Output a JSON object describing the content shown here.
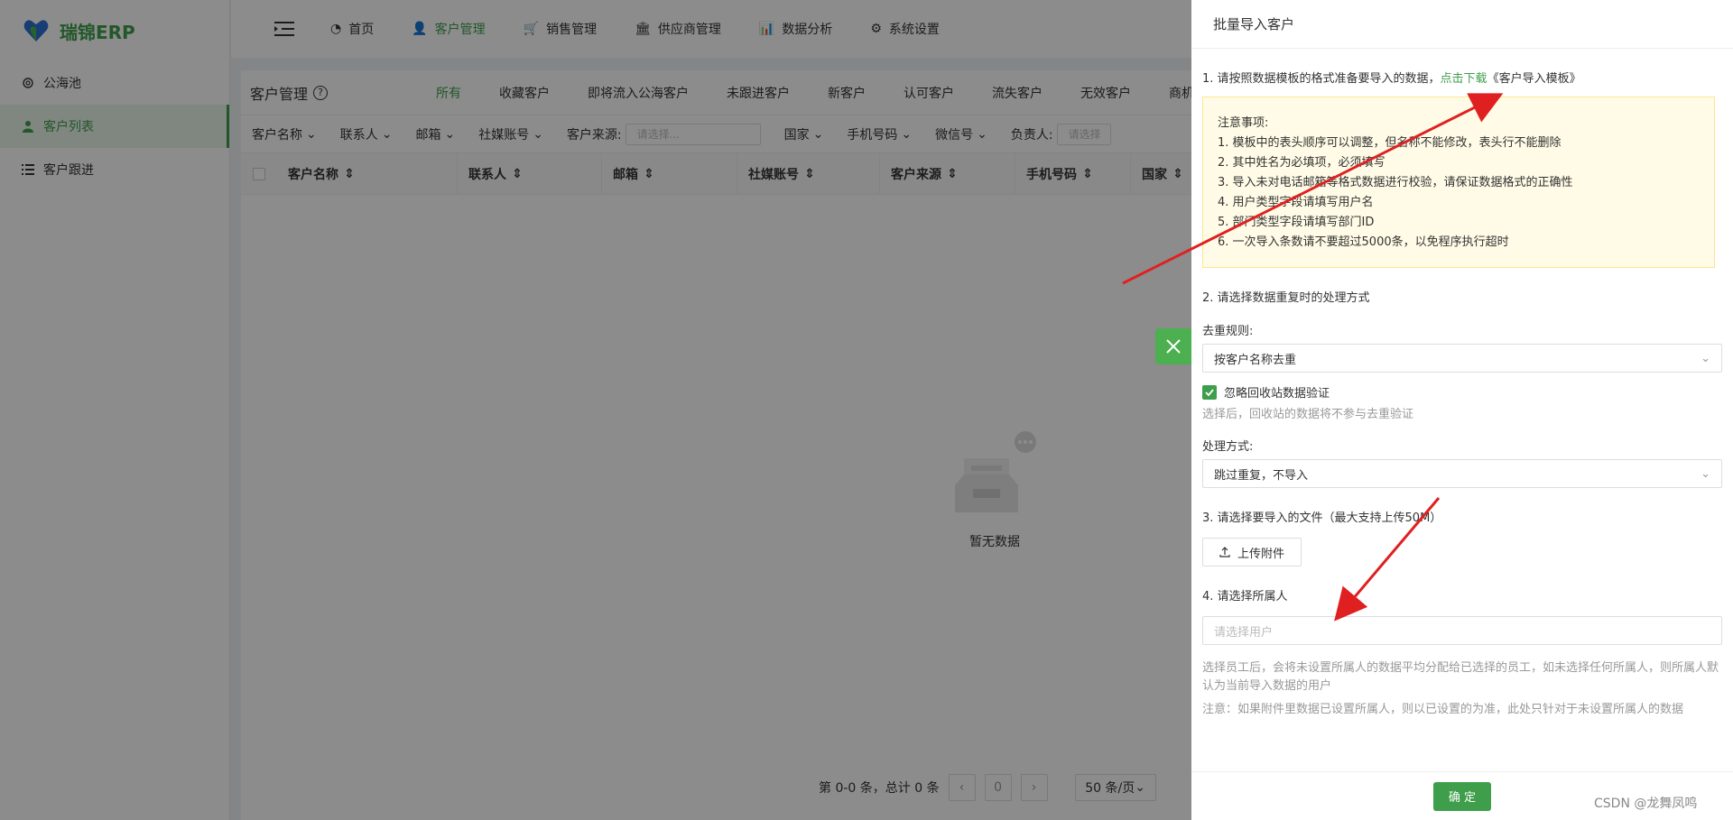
{
  "sidebar": {
    "logo_text": "瑞锦ERP",
    "items": [
      {
        "label": "公海池",
        "icon": "gear-icon"
      },
      {
        "label": "客户列表",
        "icon": "user-icon"
      },
      {
        "label": "客户跟进",
        "icon": "list-icon"
      }
    ]
  },
  "header": {
    "nav": [
      {
        "label": "首页"
      },
      {
        "label": "客户管理"
      },
      {
        "label": "销售管理"
      },
      {
        "label": "供应商管理"
      },
      {
        "label": "数据分析"
      },
      {
        "label": "系统设置"
      }
    ]
  },
  "panel": {
    "title": "客户管理",
    "tabs": [
      "所有",
      "收藏客户",
      "即将流入公海客户",
      "未跟进客户",
      "新客户",
      "认可客户",
      "流失客户",
      "无效客户",
      "商机"
    ],
    "filters": {
      "customer_name": "客户名称",
      "contact": "联系人",
      "email": "邮箱",
      "social": "社媒账号",
      "source_label": "客户来源:",
      "source_placeholder": "请选择...",
      "country": "国家",
      "phone": "手机号码",
      "wechat": "微信号",
      "owner_label": "负责人:",
      "owner_placeholder": "请选择"
    },
    "columns": [
      "客户名称",
      "联系人",
      "邮箱",
      "社媒账号",
      "客户来源",
      "手机号码",
      "国家"
    ],
    "empty_text": "暂无数据",
    "pager": {
      "summary": "第 0-0 条，总计 0 条",
      "page": "0",
      "page_size": "50 条/页"
    }
  },
  "drawer": {
    "title": "批量导入客户",
    "step1_text": "1. 请按照数据模板的格式准备要导入的数据，",
    "step1_link": "点击下载",
    "step1_template": "《客户导入模板》",
    "notice_title": "注意事项:",
    "notice_items": [
      "1. 模板中的表头顺序可以调整，但名称不能修改，表头行不能删除",
      "2. 其中姓名为必填项，必须填写",
      "3. 导入未对电话邮箱等格式数据进行校验，请保证数据格式的正确性",
      "4. 用户类型字段请填写用户名",
      "5. 部门类型字段请填写部门ID",
      "6. 一次导入条数请不要超过5000条，以免程序执行超时"
    ],
    "step2_text": "2. 请选择数据重复时的处理方式",
    "dedupe_label": "去重规则:",
    "dedupe_value": "按客户名称去重",
    "ignore_recycle_label": "忽略回收站数据验证",
    "ignore_recycle_hint": "选择后，回收站的数据将不参与去重验证",
    "process_label": "处理方式:",
    "process_value": "跳过重复，不导入",
    "step3_text": "3. 请选择要导入的文件（最大支持上传50M）",
    "upload_label": "上传附件",
    "step4_text": "4. 请选择所属人",
    "user_placeholder": "请选择用户",
    "owner_hint": "选择员工后，会将未设置所属人的数据平均分配给已选择的员工，如未选择任何所属人，则所属人默认为当前导入数据的用户",
    "owner_note": "注意：如果附件里数据已设置所属人，则以已设置的为准，此处只针对于未设置所属人的数据",
    "confirm_label": "确 定"
  },
  "watermark": "CSDN @龙舞凤鸣",
  "colors": {
    "accent": "#3f9e4b",
    "annotation_arrow": "#e02020"
  }
}
